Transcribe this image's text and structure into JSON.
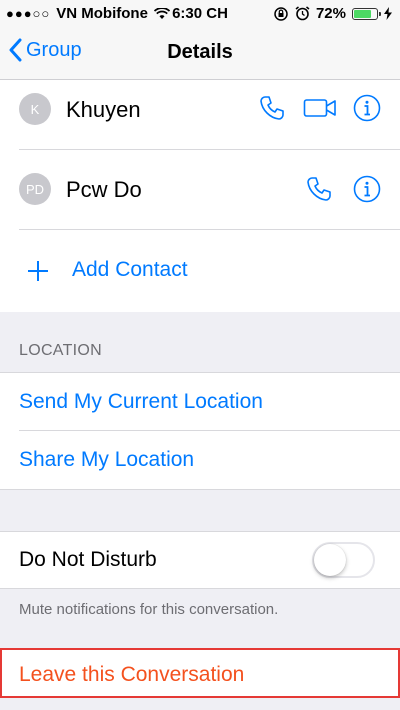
{
  "status": {
    "carrier": "VN Mobifone",
    "time": "6:30 CH",
    "battery": "72%",
    "battery_level": 0.72
  },
  "nav": {
    "back_label": "Group",
    "title": "Details"
  },
  "contacts": [
    {
      "initials": "K",
      "name": "Khuyen"
    },
    {
      "initials": "PD",
      "name": "Pcw Do"
    }
  ],
  "add_contact": {
    "label": "Add Contact"
  },
  "location": {
    "header": "LOCATION",
    "send_current": "Send My Current Location",
    "share": "Share My Location"
  },
  "dnd": {
    "label": "Do Not Disturb",
    "enabled": false,
    "note": "Mute notifications for this conversation."
  },
  "leave": {
    "label": "Leave this Conversation"
  },
  "colors": {
    "accent": "#007aff",
    "danger": "#f4511e",
    "highlight_border": "#e53935",
    "battery": "#4cd964"
  },
  "icons": [
    "signal-dots-icon",
    "wifi-icon",
    "orientation-lock-icon",
    "alarm-icon",
    "battery-icon",
    "charging-icon",
    "chevron-left-icon",
    "phone-icon",
    "video-camera-icon",
    "info-icon",
    "plus-icon"
  ]
}
